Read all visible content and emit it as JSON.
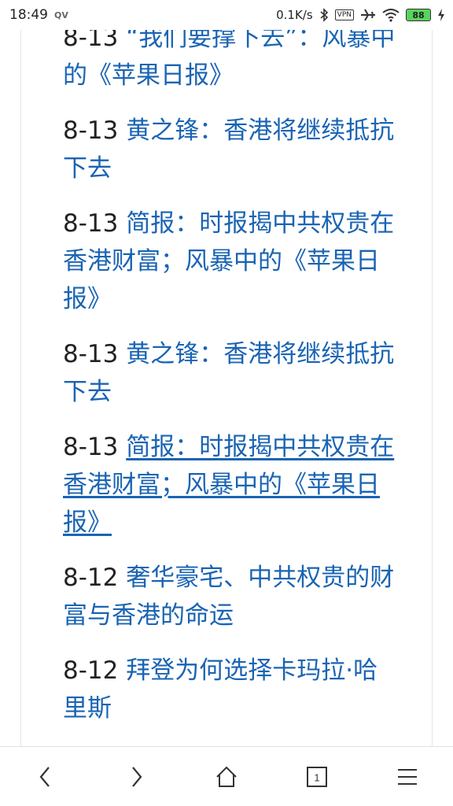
{
  "status_bar": {
    "time": "18:49",
    "qv": "QV",
    "net_speed": "0.1K/s",
    "vpn": "VPN",
    "battery": "88"
  },
  "news": [
    {
      "date": "8-13",
      "title": "“我们要撑下去”：风暴中的《苹果日报》"
    },
    {
      "date": "8-13",
      "title": "黄之锋：香港将继续抵抗下去"
    },
    {
      "date": "8-13",
      "title": "简报：时报揭中共权贵在香港财富；风暴中的《苹果日报》"
    },
    {
      "date": "8-13",
      "title": "黄之锋：香港将继续抵抗下去"
    },
    {
      "date": "8-13",
      "title": "简报：时报揭中共权贵在香港财富；风暴中的《苹果日报》"
    },
    {
      "date": "8-12",
      "title": "奢华豪宅、中共权贵的财富与香港的命运"
    },
    {
      "date": "8-12",
      "title": "拜登为何选择卡玛拉·哈里斯"
    }
  ],
  "bottom_nav": {
    "tab_count": "1",
    "icons": [
      "back-icon",
      "forward-icon",
      "home-icon",
      "tabs-icon",
      "menu-icon"
    ]
  },
  "colors": {
    "link": "#1a64b3",
    "text": "#222222"
  }
}
